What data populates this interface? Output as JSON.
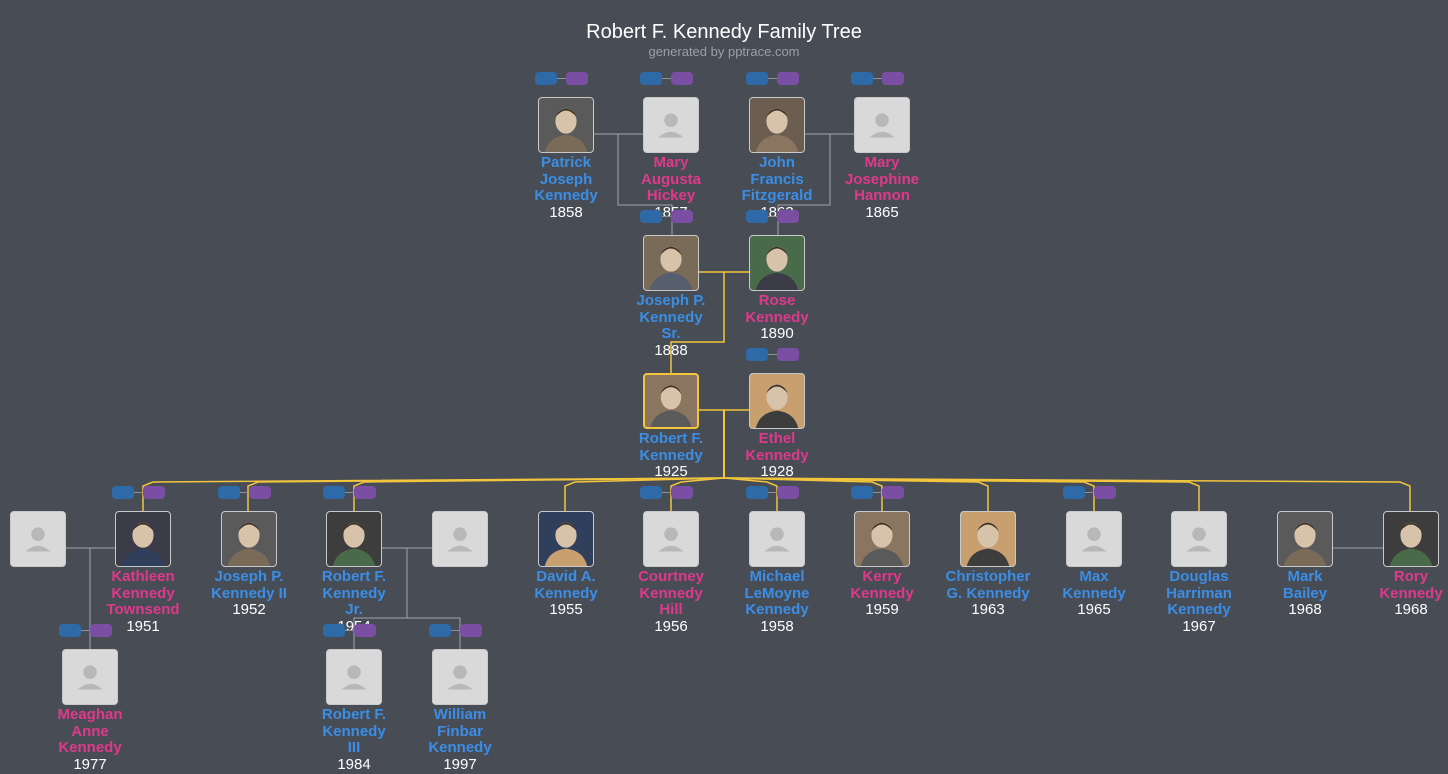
{
  "header": {
    "title": "Robert F. Kennedy Family Tree",
    "subtitle": "generated by pptrace.com"
  },
  "icons": {
    "placeholder": "person-silhouette-icon",
    "expand_parents": "expand-parents-button",
    "expand_family": "expand-family-button"
  },
  "colors": {
    "background": "#474c55",
    "male": "#3b8ee6",
    "female": "#e0398c",
    "focus_line": "#f2c53d",
    "line": "#a0a4aa"
  },
  "people": [
    {
      "id": "pjk",
      "name": "Patrick Joseph Kennedy",
      "year": "1858",
      "sex": "m",
      "photo": true,
      "controls": true
    },
    {
      "id": "mah",
      "name": "Mary Augusta Hickey",
      "year": "1857",
      "sex": "f",
      "photo": false,
      "controls": true
    },
    {
      "id": "jff",
      "name": "John Francis Fitzgerald",
      "year": "1863",
      "sex": "m",
      "photo": true,
      "controls": true
    },
    {
      "id": "mjh",
      "name": "Mary Josephine Hannon",
      "year": "1865",
      "sex": "f",
      "photo": false,
      "controls": true
    },
    {
      "id": "jpk",
      "name": "Joseph P. Kennedy Sr.",
      "year": "1888",
      "sex": "m",
      "photo": true,
      "controls": true
    },
    {
      "id": "rose",
      "name": "Rose Kennedy",
      "year": "1890",
      "sex": "f",
      "photo": true,
      "controls": true
    },
    {
      "id": "rfk",
      "name": "Robert F. Kennedy",
      "year": "1925",
      "sex": "m",
      "photo": true,
      "controls": false,
      "focus": true
    },
    {
      "id": "ethel",
      "name": "Ethel Kennedy",
      "year": "1928",
      "sex": "f",
      "photo": true,
      "controls": true
    },
    {
      "id": "kspouse",
      "name": "",
      "year": "",
      "sex": "m",
      "photo": false,
      "controls": false
    },
    {
      "id": "kath",
      "name": "Kathleen Kennedy Townsend",
      "year": "1951",
      "sex": "f",
      "photo": true,
      "controls": true
    },
    {
      "id": "jpk2",
      "name": "Joseph P. Kennedy II",
      "year": "1952",
      "sex": "m",
      "photo": true,
      "controls": true
    },
    {
      "id": "rfkjr",
      "name": "Robert F. Kennedy Jr.",
      "year": "1954",
      "sex": "m",
      "photo": true,
      "controls": true
    },
    {
      "id": "rfkjrspouse",
      "name": "",
      "year": "",
      "sex": "f",
      "photo": false,
      "controls": false
    },
    {
      "id": "david",
      "name": "David A. Kennedy",
      "year": "1955",
      "sex": "m",
      "photo": true,
      "controls": false
    },
    {
      "id": "court",
      "name": "Courtney Kennedy Hill",
      "year": "1956",
      "sex": "f",
      "photo": false,
      "controls": true
    },
    {
      "id": "mich",
      "name": "Michael LeMoyne Kennedy",
      "year": "1958",
      "sex": "m",
      "photo": false,
      "controls": true
    },
    {
      "id": "kerry",
      "name": "Kerry Kennedy",
      "year": "1959",
      "sex": "f",
      "photo": true,
      "controls": true
    },
    {
      "id": "chris",
      "name": "Christopher G. Kennedy",
      "year": "1963",
      "sex": "m",
      "photo": true,
      "controls": false
    },
    {
      "id": "max",
      "name": "Max Kennedy",
      "year": "1965",
      "sex": "m",
      "photo": false,
      "controls": true
    },
    {
      "id": "doug",
      "name": "Douglas Harriman Kennedy",
      "year": "1967",
      "sex": "m",
      "photo": false,
      "controls": false
    },
    {
      "id": "mark",
      "name": "Mark Bailey",
      "year": "1968",
      "sex": "m",
      "photo": true,
      "controls": false
    },
    {
      "id": "rory",
      "name": "Rory Kennedy",
      "year": "1968",
      "sex": "f",
      "photo": true,
      "controls": false
    },
    {
      "id": "meag",
      "name": "Meaghan Anne Kennedy",
      "year": "1977",
      "sex": "f",
      "photo": false,
      "controls": true
    },
    {
      "id": "rfk3",
      "name": "Robert F. Kennedy III",
      "year": "1984",
      "sex": "m",
      "photo": false,
      "controls": true
    },
    {
      "id": "wfk",
      "name": "William Finbar Kennedy",
      "year": "1997",
      "sex": "m",
      "photo": false,
      "controls": true
    }
  ]
}
